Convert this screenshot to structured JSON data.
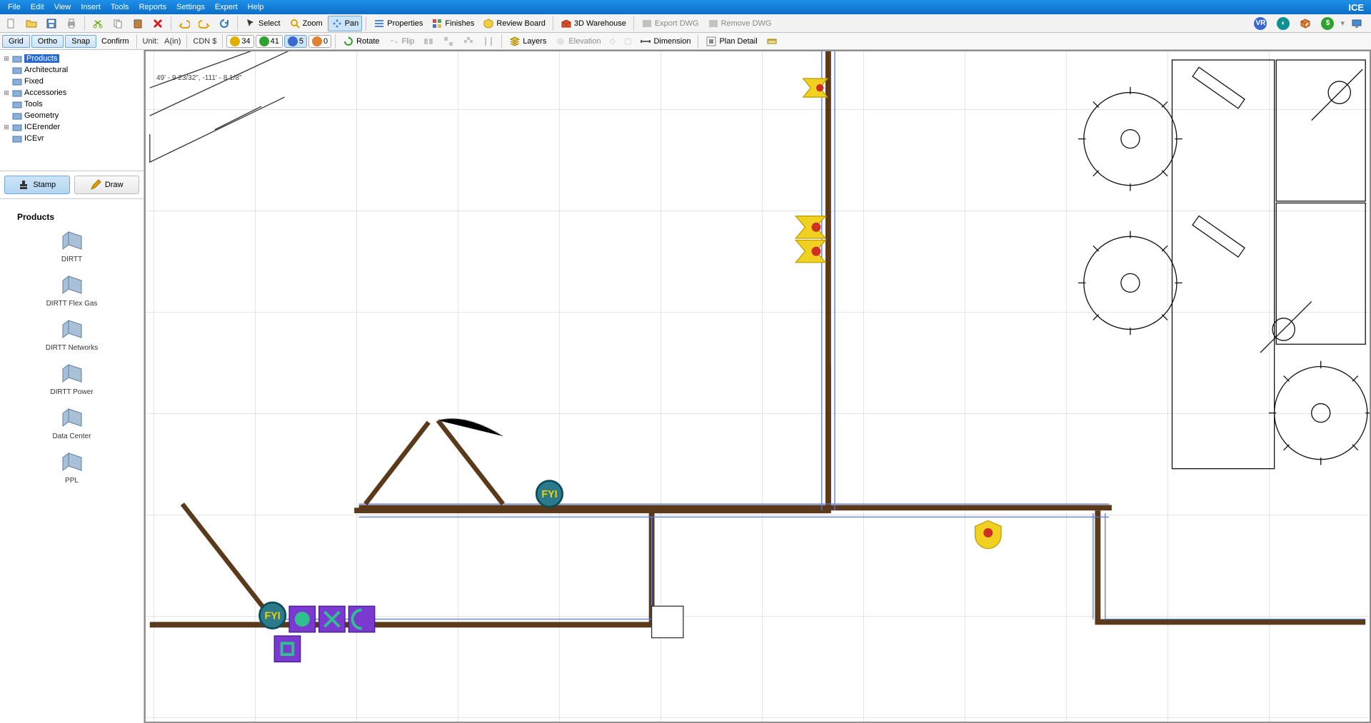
{
  "brand": "ICE",
  "menus": [
    "File",
    "Edit",
    "View",
    "Insert",
    "Tools",
    "Reports",
    "Settings",
    "Expert",
    "Help"
  ],
  "toolbar1": {
    "select": "Select",
    "zoom": "Zoom",
    "pan": "Pan",
    "properties": "Properties",
    "finishes": "Finishes",
    "review_board": "Review Board",
    "warehouse": "3D Warehouse",
    "export_dwg": "Export DWG",
    "remove_dwg": "Remove DWG"
  },
  "toolbar2": {
    "grid": "Grid",
    "ortho": "Ortho",
    "snap": "Snap",
    "confirm": "Confirm",
    "unit_label": "Unit:",
    "unit_value": "A(in)",
    "currency": "CDN $",
    "badge_y": "34",
    "badge_g": "41",
    "badge_b": "5",
    "badge_o": "0",
    "rotate": "Rotate",
    "flip": "Flip",
    "layers": "Layers",
    "elevation": "Elevation",
    "dimension": "Dimension",
    "plan_detail": "Plan Detail"
  },
  "tree": [
    {
      "label": "Products",
      "selected": true,
      "expandable": true
    },
    {
      "label": "Architectural",
      "expandable": false
    },
    {
      "label": "Fixed",
      "expandable": false
    },
    {
      "label": "Accessories",
      "expandable": true
    },
    {
      "label": "Tools",
      "expandable": false
    },
    {
      "label": "Geometry",
      "expandable": false
    },
    {
      "label": "ICErender",
      "expandable": true
    },
    {
      "label": "ICEvr",
      "expandable": false
    }
  ],
  "stamp": "Stamp",
  "draw": "Draw",
  "palette_title": "Products",
  "palette": [
    {
      "label": "DIRTT"
    },
    {
      "label": "DIRTT Flex Gas"
    },
    {
      "label": "DIRTT Networks"
    },
    {
      "label": "DIRTT Power"
    },
    {
      "label": "Data Center"
    },
    {
      "label": "PPL"
    }
  ],
  "coord_readout": "49' - 9 23/32\", -111' - 8 1/8\"",
  "marker_text": "FYI"
}
